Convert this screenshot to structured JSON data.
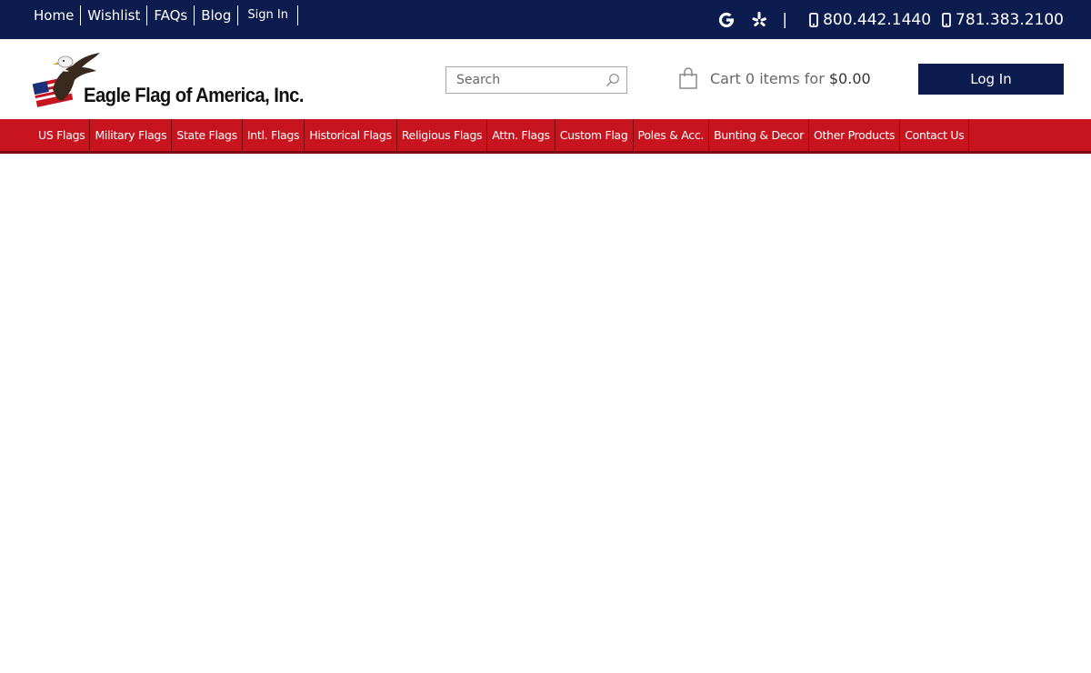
{
  "topbar": {
    "links": [
      {
        "label": "Home"
      },
      {
        "label": "Wishlist"
      },
      {
        "label": "FAQs"
      },
      {
        "label": "Blog"
      },
      {
        "label": "Sign In"
      }
    ],
    "social": [
      {
        "icon": "google-icon"
      },
      {
        "icon": "yelp-icon"
      }
    ],
    "separator": "|",
    "phones": [
      {
        "icon": "mobile-phone-icon",
        "number": "800.442.1440"
      },
      {
        "icon": "mobile-phone-icon",
        "number": "781.383.2100"
      }
    ]
  },
  "header": {
    "logo_text": "Eagle Flag of America, Inc.",
    "search": {
      "placeholder": "Search",
      "icon": "search-icon"
    },
    "cart": {
      "icon": "shopping-bag-icon",
      "label": "Cart",
      "count": "0",
      "items_for": "items for",
      "total": "$0.00"
    },
    "login_label": "Log In"
  },
  "nav": {
    "items": [
      {
        "label": "US Flags"
      },
      {
        "label": "Military Flags"
      },
      {
        "label": "State Flags"
      },
      {
        "label": "Intl. Flags"
      },
      {
        "label": "Historical Flags"
      },
      {
        "label": "Religious Flags"
      },
      {
        "label": "Attn. Flags"
      },
      {
        "label": "Custom Flag"
      },
      {
        "label": "Poles & Acc."
      },
      {
        "label": "Bunting & Decor"
      },
      {
        "label": "Other Products"
      },
      {
        "label": "Contact Us"
      }
    ]
  },
  "colors": {
    "navy": "#0d1c4f",
    "red": "#c8141e"
  }
}
